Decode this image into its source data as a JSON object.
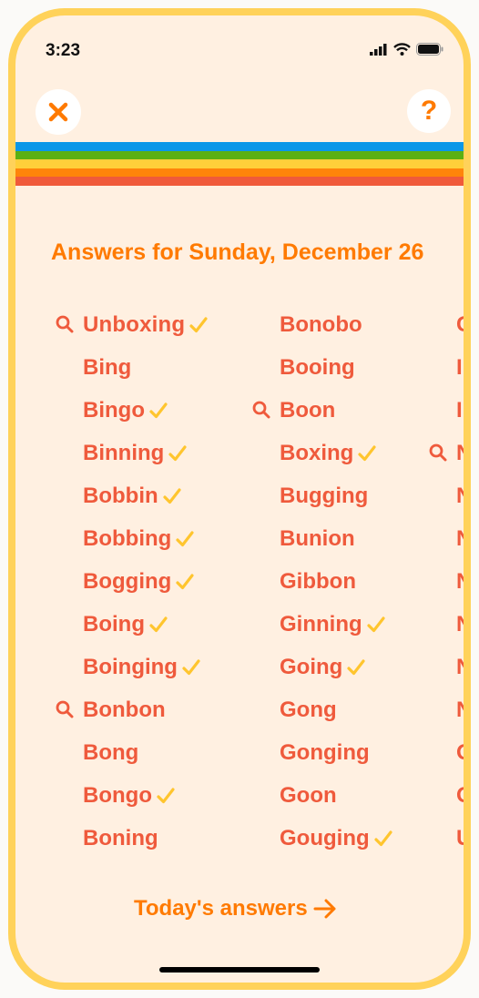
{
  "status_bar": {
    "time": "3:23"
  },
  "header": {
    "close_icon": "close-icon",
    "help_label": "?"
  },
  "stripe_colors": [
    "#0a97e8",
    "#5bb012",
    "#ffcf3a",
    "#ff840a",
    "#f05a3a"
  ],
  "heading": "Answers for Sunday, December 26",
  "colors": {
    "word": "#ef5a3c",
    "accent": "#ff7a00",
    "check": "#ffc52e",
    "frame": "#ffd25a"
  },
  "columns": [
    [
      {
        "text": "Unboxing",
        "found": true,
        "search": true,
        "bold": true
      },
      {
        "text": "Bing",
        "found": false
      },
      {
        "text": "Bingo",
        "found": true
      },
      {
        "text": "Binning",
        "found": true
      },
      {
        "text": "Bobbin",
        "found": true
      },
      {
        "text": "Bobbing",
        "found": true
      },
      {
        "text": "Bogging",
        "found": true
      },
      {
        "text": "Boing",
        "found": true
      },
      {
        "text": "Boinging",
        "found": true
      },
      {
        "text": "Bonbon",
        "found": false,
        "search": true
      },
      {
        "text": "Bong",
        "found": false
      },
      {
        "text": "Bongo",
        "found": true
      },
      {
        "text": "Boning",
        "found": false
      }
    ],
    [
      {
        "text": "Bonobo",
        "found": false
      },
      {
        "text": "Booing",
        "found": false
      },
      {
        "text": "Boon",
        "found": false,
        "search": true
      },
      {
        "text": "Boxing",
        "found": true
      },
      {
        "text": "Bugging",
        "found": false
      },
      {
        "text": "Bunion",
        "found": false
      },
      {
        "text": "Gibbon",
        "found": false
      },
      {
        "text": "Ginning",
        "found": true
      },
      {
        "text": "Going",
        "found": true
      },
      {
        "text": "Gong",
        "found": false
      },
      {
        "text": "Gonging",
        "found": false
      },
      {
        "text": "Goon",
        "found": false
      },
      {
        "text": "Gouging",
        "found": true
      }
    ],
    [
      {
        "text": "G"
      },
      {
        "text": "I"
      },
      {
        "text": "I"
      },
      {
        "text": "N",
        "search": true
      },
      {
        "text": "N"
      },
      {
        "text": "N"
      },
      {
        "text": "N"
      },
      {
        "text": "N"
      },
      {
        "text": "N"
      },
      {
        "text": "N"
      },
      {
        "text": "O"
      },
      {
        "text": "O"
      },
      {
        "text": "U"
      }
    ]
  ],
  "footer": {
    "link_label": "Today's answers",
    "arrow_icon": "arrow-right-icon"
  }
}
